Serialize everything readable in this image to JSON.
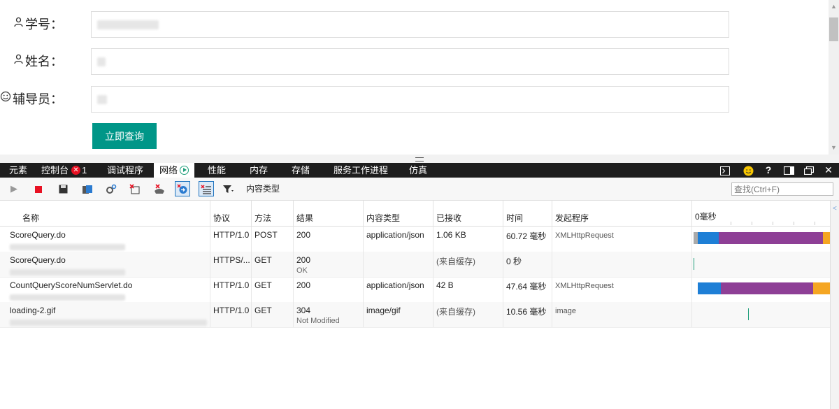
{
  "form": {
    "student_id_label": "学号：",
    "name_label": "姓名：",
    "counselor_label": "辅导员：",
    "query_button": "立即查询"
  },
  "devtools": {
    "tabs": [
      {
        "label": "元素"
      },
      {
        "label": "控制台",
        "badge": "1"
      },
      {
        "label": "调试程序"
      },
      {
        "label": "网络"
      },
      {
        "label": "性能"
      },
      {
        "label": "内存"
      },
      {
        "label": "存储"
      },
      {
        "label": "服务工作进程"
      },
      {
        "label": "仿真"
      }
    ],
    "active_tab": "网络",
    "right_icons": [
      "terminal-icon",
      "smiley-icon",
      "help-icon",
      "dock-icon",
      "undock-icon",
      "close-icon"
    ],
    "help_glyph": "?",
    "close_glyph": "✕",
    "toolbar": {
      "icons": [
        "play-icon",
        "stop-record-icon",
        "save-icon",
        "import-icon",
        "settings-icon",
        "clear-icon",
        "clear-cache-icon",
        "always-refresh-icon",
        "clear-entries-icon",
        "filter-icon"
      ],
      "filter_label": "内容类型",
      "find_placeholder": "查找(Ctrl+F)"
    },
    "columns": [
      "名称",
      "协议",
      "方法",
      "结果",
      "内容类型",
      "已接收",
      "时间",
      "发起程序",
      "0毫秒"
    ],
    "rows": [
      {
        "name": "ScoreQuery.do",
        "protocol": "HTTP/1.0",
        "method": "POST",
        "result": "200",
        "result_sub": "",
        "type": "application/json",
        "received": "1.06 KB",
        "time": "60.72 毫秒",
        "initiator": "XMLHttpRequest"
      },
      {
        "name": "ScoreQuery.do",
        "protocol": "HTTPS/...",
        "method": "GET",
        "result": "200",
        "result_sub": "OK",
        "type": "",
        "received": "(来自缓存)",
        "time": "0 秒",
        "initiator": ""
      },
      {
        "name": "CountQueryScoreNumServlet.do",
        "protocol": "HTTP/1.0",
        "method": "GET",
        "result": "200",
        "result_sub": "",
        "type": "application/json",
        "received": "42 B",
        "time": "47.64 毫秒",
        "initiator": "XMLHttpRequest"
      },
      {
        "name": "loading-2.gif",
        "protocol": "HTTP/1.0",
        "method": "GET",
        "result": "304",
        "result_sub": "Not Modified",
        "type": "image/gif",
        "received": "(来自缓存)",
        "time": "10.56 毫秒",
        "initiator": "image"
      }
    ],
    "colors": {
      "wait": "#1e7fd6",
      "receive": "#8e3f96",
      "tail": "#f5a623",
      "queue": "#aaaaaa",
      "line": "#1e9e7a"
    }
  }
}
